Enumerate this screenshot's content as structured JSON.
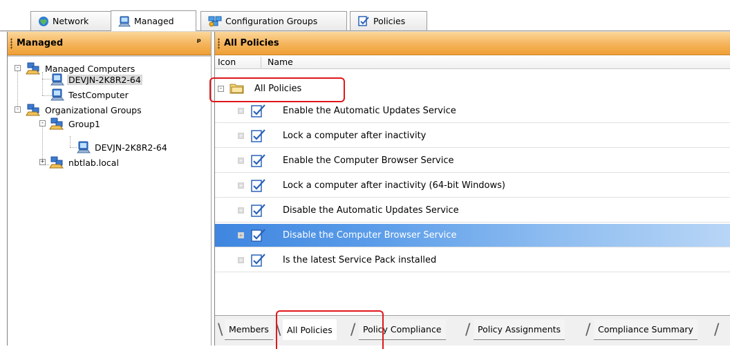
{
  "top_tabs": [
    {
      "label": "Network",
      "icon": "globe-icon"
    },
    {
      "label": "Managed",
      "icon": "computer-icon"
    },
    {
      "label": "Configuration Groups",
      "icon": "group-icon"
    },
    {
      "label": "Policies",
      "icon": "policy-icon"
    }
  ],
  "active_top_tab": "Managed",
  "left_pane": {
    "title": "Managed",
    "pin_glyph": "\u0004",
    "tree": [
      {
        "label": "Managed Computers",
        "icon": "computer-group-icon",
        "expander": "-"
      },
      {
        "label": "DEVJN-2K8R2-64",
        "icon": "computer-icon",
        "selected": true
      },
      {
        "label": "TestComputer",
        "icon": "computer-icon"
      },
      {
        "label": "Organizational Groups",
        "icon": "computer-group-icon",
        "expander": "-"
      },
      {
        "label": "Group1",
        "icon": "computer-group-icon",
        "expander": "-"
      },
      {
        "label": "DEVJN-2K8R2-64",
        "icon": "computer-icon"
      },
      {
        "label": "nbtlab.local",
        "icon": "computer-group-icon",
        "expander": "+"
      }
    ]
  },
  "right_pane": {
    "title": "All Policies",
    "columns": [
      "Icon",
      "Name"
    ],
    "group": {
      "label": "All Policies",
      "expander": "-",
      "icon": "folder-icon"
    },
    "policies": [
      {
        "label": "Enable the Automatic Updates Service",
        "selected": false
      },
      {
        "label": "Lock a computer after inactivity",
        "selected": false
      },
      {
        "label": "Enable the Computer Browser Service",
        "selected": false
      },
      {
        "label": "Lock a computer after inactivity (64-bit Windows)",
        "selected": false
      },
      {
        "label": "Disable the Automatic Updates Service",
        "selected": false
      },
      {
        "label": "Disable the Computer Browser Service",
        "selected": true
      },
      {
        "label": "Is the latest Service Pack installed",
        "selected": false
      }
    ],
    "bottom_tabs": [
      "Members",
      "All Policies",
      "Policy Compliance",
      "Policy Assignments",
      "Compliance Summary"
    ],
    "active_bottom_tab": "All Policies"
  },
  "colors": {
    "header_orange": "#f4b35a",
    "selection_blue": "#3f86e0",
    "annotation_red": "#e0161b"
  }
}
